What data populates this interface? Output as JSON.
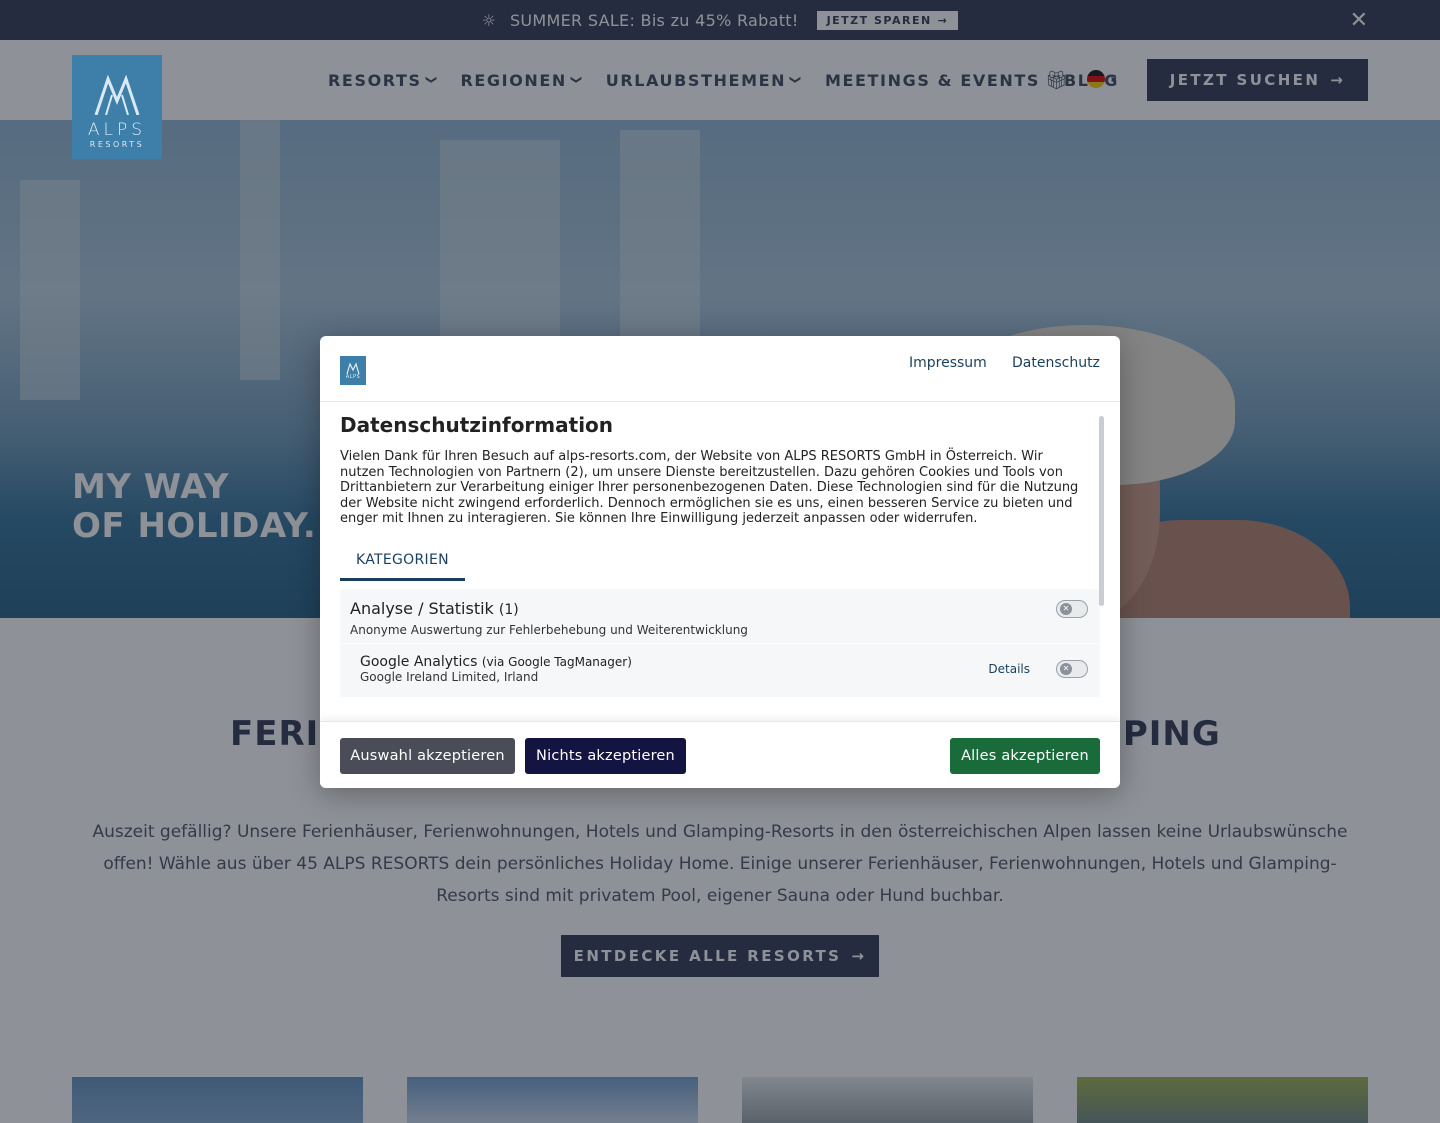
{
  "promo": {
    "text": "SUMMER SALE: Bis zu 45% Rabatt!",
    "button": "JETZT SPAREN"
  },
  "logo": {
    "line1": "ALPS",
    "line2": "RESORTS"
  },
  "nav": {
    "items": [
      {
        "label": "RESORTS",
        "dropdown": true
      },
      {
        "label": "REGIONEN",
        "dropdown": true
      },
      {
        "label": "URLAUBSTHEMEN",
        "dropdown": true
      },
      {
        "label": "MEETINGS & EVENTS",
        "dropdown": false
      },
      {
        "label": "BLOG",
        "dropdown": false
      }
    ],
    "search_button": "JETZT SUCHEN",
    "language": "de"
  },
  "hero": {
    "line1": "MY WAY",
    "line2": "OF HOLIDAY."
  },
  "content": {
    "heading_left": "FERIE",
    "heading_right": "MPING",
    "intro": "Auszeit gefällig? Unsere Ferienhäuser, Ferienwohnungen, Hotels und Glamping-Resorts in den österreichischen Alpen lassen keine Urlaubswünsche offen! Wähle aus über 45 ALPS RESORTS dein persönliches Holiday Home. Einige unserer Ferienhäuser, Ferienwohnungen, Hotels und Glamping-Resorts sind mit privatem Pool, eigener Sauna oder Hund buchbar.",
    "discover_button": "ENTDECKE ALLE RESORTS"
  },
  "consent": {
    "links": {
      "impressum": "Impressum",
      "datenschutz": "Datenschutz"
    },
    "title": "Datenschutzinformation",
    "text": "Vielen Dank für Ihren Besuch auf alps-resorts.com, der Website von ALPS RESORTS GmbH in Österreich. Wir nutzen Technologien von Partnern (2), um unsere Dienste bereitzustellen. Dazu gehören Cookies und Tools von Drittanbietern zur Verarbeitung einiger Ihrer personenbezogenen Daten. Diese Technologien sind für die Nutzung der Website nicht zwingend erforderlich. Dennoch ermöglichen sie es uns, einen besseren Service zu bieten und enger mit Ihnen zu interagieren. Sie können Ihre Einwilligung jederzeit anpassen oder widerrufen.",
    "tab": "KATEGORIEN",
    "category": {
      "title": "Analyse / Statistik",
      "count": "(1)",
      "description": "Anonyme Auswertung zur Fehlerbehebung und Weiterentwicklung",
      "enabled": false
    },
    "service": {
      "name": "Google Analytics",
      "via": "(via Google TagManager)",
      "company": "Google Ireland Limited, Irland",
      "details": "Details",
      "enabled": false
    },
    "buttons": {
      "accept_selection": "Auswahl akzeptieren",
      "accept_none": "Nichts akzeptieren",
      "accept_all": "Alles akzeptieren"
    }
  },
  "colors": {
    "navy": "#2c3550",
    "brand_blue": "#3d7fa8",
    "accept_all_green": "#1a6b3a",
    "accept_none_navy": "#141442",
    "accept_selection_gray": "#4a4d57"
  }
}
